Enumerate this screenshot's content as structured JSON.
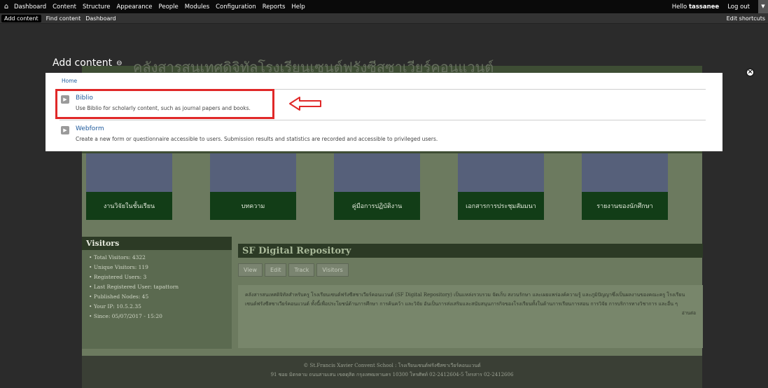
{
  "toolbar": {
    "menu": [
      "Dashboard",
      "Content",
      "Structure",
      "Appearance",
      "People",
      "Modules",
      "Configuration",
      "Reports",
      "Help"
    ],
    "hello": "Hello",
    "username": "tassanee",
    "logout": "Log out"
  },
  "shortcuts": {
    "items": [
      "Add content",
      "Find content",
      "Dashboard"
    ],
    "edit": "Edit shortcuts"
  },
  "overlay": {
    "title": "Add content",
    "bg_site_title": "คลังสารสนเทศดิจิทัลโรงเรียนเซนต์ฟรังซีสซาเวียร์คอนแวนต์",
    "breadcrumb": "Home",
    "types": [
      {
        "label": "Biblio",
        "description": "Use Biblio for scholarly content, such as journal papers and books."
      },
      {
        "label": "Webform",
        "description": "Create a new form or questionnaire accessible to users. Submission results and statistics are recorded and accessible to privileged users."
      }
    ]
  },
  "tiles": [
    "งานวิจัยในชั้นเรียน",
    "บทความ",
    "คู่มือการปฏิบัติงาน",
    "เอกสารการประชุมสัมมนา",
    "รายงานของนักศึกษา"
  ],
  "visitors": {
    "title": "Visitors",
    "items": [
      "Total Visitors: 4322",
      "Unique Visitors: 119",
      "Registered Users: 3",
      "Last Registered User: tapattorn",
      "Published Nodes: 45",
      "Your IP: 10.5.2.35",
      "Since: 05/07/2017 - 15:20"
    ]
  },
  "repo": {
    "title": "SF Digital Repository",
    "tabs": [
      "View",
      "Edit",
      "Track",
      "Visitors"
    ],
    "body": "คลังสารสนเทศดิจิทัลสำหรับครู โรงเรียนเซนต์ฟรังซีสซาเวียร์คอนแวนต์ (SF Digital Repository) เป็นแหล่งรวบรวม จัดเก็บ สงวนรักษา และเผยแพร่องค์ความรู้ และภูมิปัญญาซึ่งเป็นผลงานของคณะครู โรงเรียนเซนต์ฟรังซีสซาเวียร์คอนแวนต์ ทั้งนี้เพื่อประโยชน์ด้านการศึกษา การค้นคว้า และวิจัย อันเป็นการส่งเสริมและสนับสนุนภารกิจของโรงเรียนทั้งในด้านการเรียนการสอน การวิจัย การบริการทางวิชาการ และอื่น ๆ",
    "more": "อ่านต่อ"
  },
  "footer": {
    "line1": "© St.Francis Xavier Convent School : โรงเรียนเซนต์ฟรังซีสซาเวียร์คอนแวนต์",
    "line2": "91 ซอย มิตรคาม ถนนสามเสน เขตดุสิต กรุงเทพมหานคร 10300 โทรศัพท์ 02-2412604-5 โทรสาร 02-2412606"
  },
  "colors": {
    "highlight": "#e02828",
    "link": "#1e5a9c",
    "toolbar": "#0a0a0a"
  }
}
